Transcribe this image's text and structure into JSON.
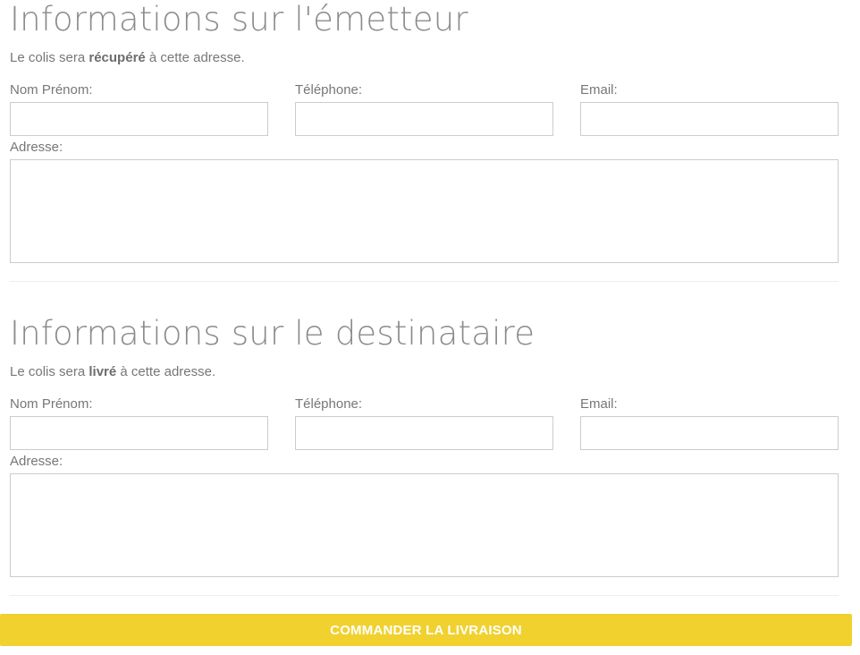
{
  "sender": {
    "title": "Informations sur l'émetteur",
    "subtitle_before": "Le colis sera ",
    "subtitle_bold": "récupéré",
    "subtitle_after": " à cette adresse.",
    "name_label": "Nom Prénom:",
    "name_value": "",
    "phone_label": "Téléphone:",
    "phone_value": "",
    "email_label": "Email:",
    "email_value": "",
    "address_label": "Adresse:",
    "address_value": ""
  },
  "recipient": {
    "title": "Informations sur le destinataire",
    "subtitle_before": "Le colis sera ",
    "subtitle_bold": "livré",
    "subtitle_after": " à cette adresse.",
    "name_label": "Nom Prénom:",
    "name_value": "",
    "phone_label": "Téléphone:",
    "phone_value": "",
    "email_label": "Email:",
    "email_value": "",
    "address_label": "Adresse:",
    "address_value": ""
  },
  "submit_button": {
    "label": "COMMANDER LA LIVRAISON",
    "background_color": "#f0d12e",
    "text_color": "#ffffff"
  }
}
